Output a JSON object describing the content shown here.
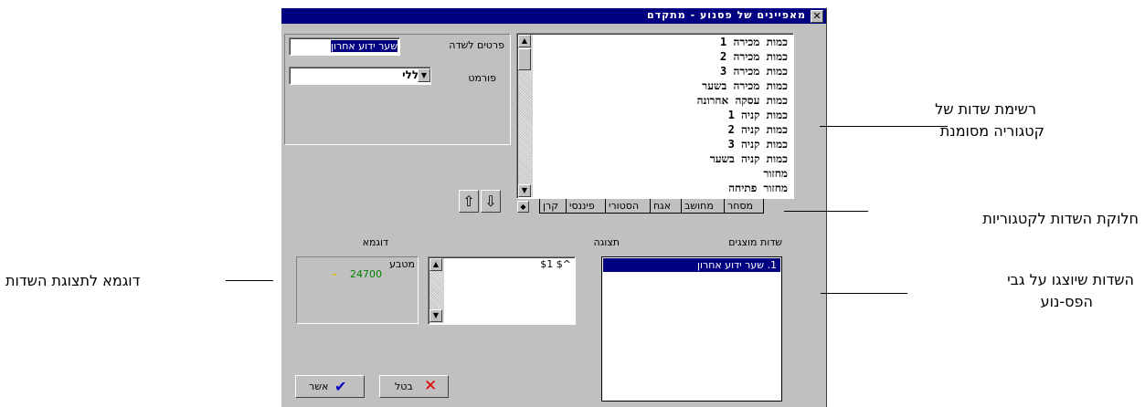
{
  "window": {
    "title": "מאפיינים של פסנוע - מתקדם",
    "close_glyph": "✕"
  },
  "field_list": {
    "items": [
      "כמות מכירה 1",
      "כמות מכירה 2",
      "כמות מכירה 3",
      "כמות מכירה בשער",
      "כמות עסקה אחרונה",
      "כמות קניה 1",
      "כמות קניה 2",
      "כמות קניה 3",
      "כמות קניה בשער",
      "מחזור",
      "מחזור פתיחה"
    ]
  },
  "tabs": [
    "מסחר",
    "מחושב",
    "אגח",
    "הסטורי",
    "פיננסי",
    "קרן"
  ],
  "tab_more_glyph": "◆",
  "details": {
    "field_label": "פרטים לשדה",
    "field_value": "שער ידוע אחרון",
    "format_label": "פורמט",
    "format_value": "כללי"
  },
  "move": {
    "up_glyph": "⇧",
    "down_glyph": "⇩"
  },
  "displayed": {
    "label": "שדות מוצגים",
    "items": [
      "1.  שער ידוע אחרון"
    ]
  },
  "display": {
    "label": "תצוגה",
    "items": [
      "^$ $1"
    ]
  },
  "example": {
    "label": "דוגמא",
    "line1": "מטבע",
    "value": "24700",
    "marker": "–"
  },
  "buttons": {
    "ok_label": "אשר",
    "cancel_label": "בטל",
    "ok_icon": "✔",
    "cancel_icon": "✕"
  },
  "callouts": {
    "field_list_line1": "רשימת שדות של",
    "field_list_line2": "קטגוריה מסומנת",
    "tabs": "חלוקת השדות לקטגוריות",
    "displayed_line1": "השדות שיוצגו על גבי",
    "displayed_line2": "הפס-נוע",
    "example": "דוגמא לתצוגת השדות"
  },
  "colors": {
    "titlebar": "#000080",
    "selection": "#000080",
    "example_value": "#008000",
    "example_marker": "#e0c000",
    "ok_check": "#0000c0",
    "cancel_x": "#e00000"
  }
}
